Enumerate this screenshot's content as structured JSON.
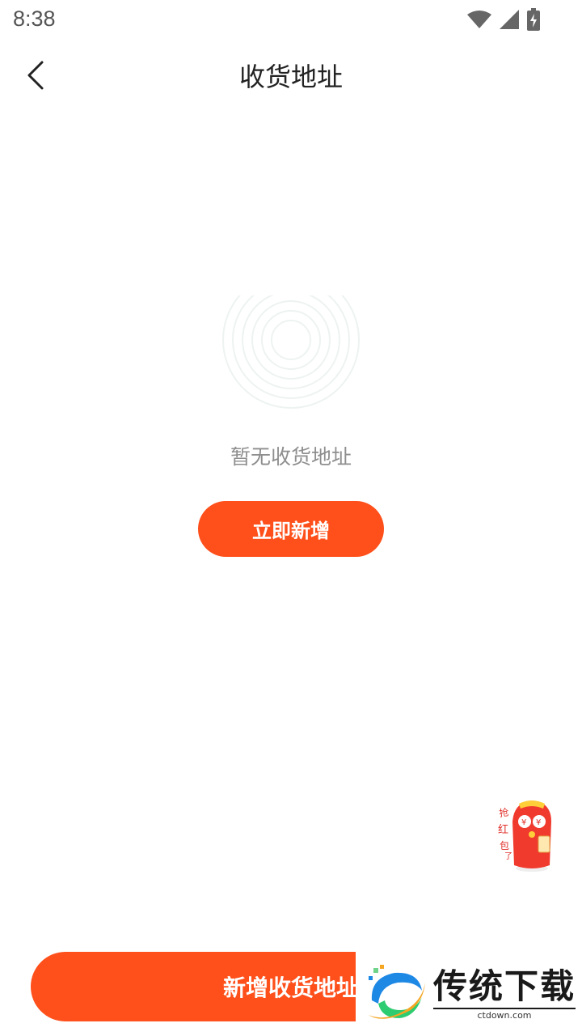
{
  "status_bar": {
    "time": "8:38"
  },
  "header": {
    "title": "收货地址"
  },
  "empty_state": {
    "message": "暂无收货地址",
    "add_now_label": "立即新增"
  },
  "floating": {
    "redpacket_text": "抢红包了"
  },
  "bottom_bar": {
    "add_address_label": "新增收货地址"
  },
  "watermark": {
    "title": "传统下载",
    "subtitle": "ctdown.com"
  },
  "colors": {
    "accent": "#ff4f1a",
    "text_primary": "#222222",
    "text_muted": "#8e8e8e"
  }
}
